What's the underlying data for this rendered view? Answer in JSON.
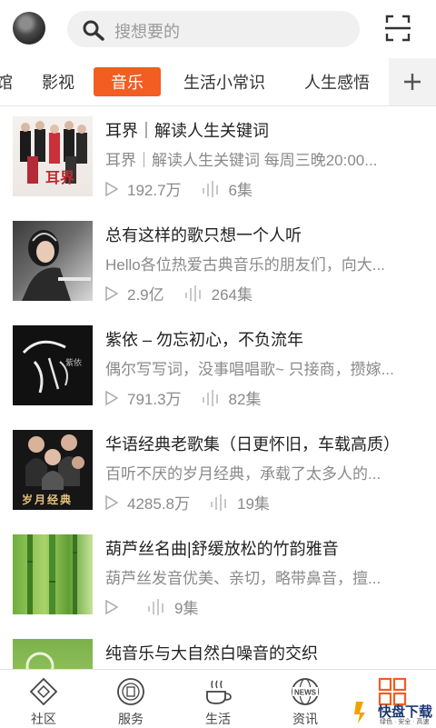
{
  "header": {
    "search_placeholder": "搜想要的"
  },
  "tabs": [
    {
      "label": "馆"
    },
    {
      "label": "影视"
    },
    {
      "label": "音乐"
    },
    {
      "label": "生活小常识"
    },
    {
      "label": "人生感悟"
    }
  ],
  "active_tab": "音乐",
  "items": [
    {
      "title": "耳界｜解读人生关键词",
      "desc": "耳界｜解读人生关键词 每周三晚20:00...",
      "plays": "192.7万",
      "episodes": "6集"
    },
    {
      "title": "总有这样的歌只想一个人听",
      "desc": "Hello各位热爱古典音乐的朋友们，向大...",
      "plays": "2.9亿",
      "episodes": "264集"
    },
    {
      "title": "紫依 – 勿忘初心，不负流年",
      "desc": "偶尔写写词，没事唱唱歌~ 只接商，攒嫁...",
      "plays": "791.3万",
      "episodes": "82集"
    },
    {
      "title": "华语经典老歌集（日更怀旧，车载高质）",
      "desc": "百听不厌的岁月经典，承载了太多人的...",
      "plays": "4285.8万",
      "episodes": "19集"
    },
    {
      "title": "葫芦丝名曲|舒缓放松的竹韵雅音",
      "desc": "葫芦丝发音优美、亲切，略带鼻音，擅...",
      "plays": "",
      "episodes": "9集"
    },
    {
      "title": "纯音乐与大自然白噪音的交织",
      "desc": "",
      "plays": "",
      "episodes": ""
    }
  ],
  "thumb_text": {
    "item1": "耳界",
    "item3": "紫依",
    "item4": "岁月经典"
  },
  "bottom_nav": [
    {
      "label": "社区",
      "icon": "community-icon"
    },
    {
      "label": "服务",
      "icon": "service-icon"
    },
    {
      "label": "生活",
      "icon": "coffee-icon"
    },
    {
      "label": "资讯",
      "icon": "news-globe-icon"
    },
    {
      "label": "",
      "icon": "grid-icon"
    }
  ],
  "watermark": {
    "text": "快盘下载",
    "sub": "绿色 · 安全 · 高速"
  },
  "colors": {
    "accent": "#f25d22"
  }
}
